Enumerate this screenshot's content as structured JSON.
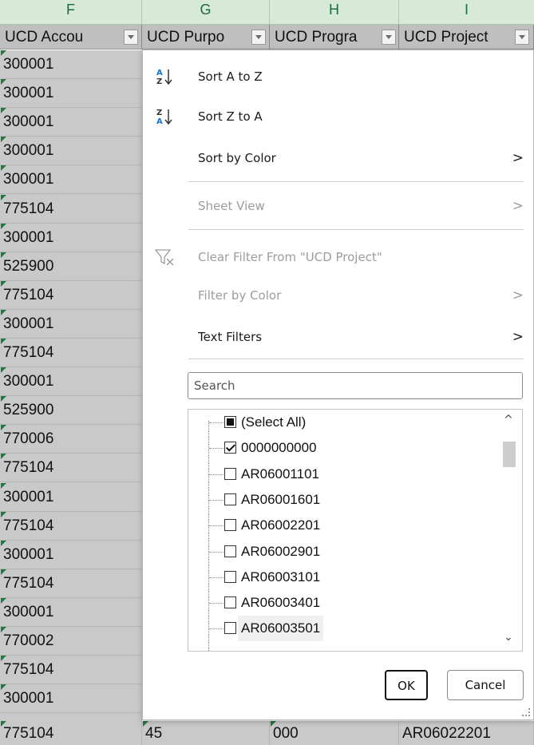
{
  "column_letters": [
    "F",
    "G",
    "H",
    "I"
  ],
  "headers": [
    {
      "label": "UCD Accou",
      "has_dropdown": true
    },
    {
      "label": "UCD Purpo",
      "has_dropdown": true
    },
    {
      "label": "UCD Progra",
      "has_dropdown": true
    },
    {
      "label": "UCD Project",
      "has_dropdown": true
    }
  ],
  "col_f_values": [
    "300001",
    "300001",
    "300001",
    "300001",
    "300001",
    "775104",
    "300001",
    "525900",
    "775104",
    "300001",
    "775104",
    "300001",
    "525900",
    "770006",
    "775104",
    "300001",
    "775104",
    "300001",
    "775104",
    "300001",
    "770002",
    "775104",
    "300001"
  ],
  "bottom_row": {
    "f": "775104",
    "g": "45",
    "h": "000",
    "i": "AR06022201"
  },
  "menu": {
    "sort_az": "Sort A to Z",
    "sort_za": "Sort Z to A",
    "sort_by_color": "Sort by Color",
    "sheet_view": "Sheet View",
    "clear_filter": "Clear Filter From \"UCD Project\"",
    "filter_by_color": "Filter by Color",
    "text_filters": "Text Filters",
    "chevron": ">"
  },
  "search": {
    "placeholder": "Search"
  },
  "filter_list": [
    {
      "label": "(Select All)",
      "state": "partial"
    },
    {
      "label": "0000000000",
      "state": "checked"
    },
    {
      "label": "AR06001101",
      "state": "unchecked"
    },
    {
      "label": "AR06001601",
      "state": "unchecked"
    },
    {
      "label": "AR06002201",
      "state": "unchecked"
    },
    {
      "label": "AR06002901",
      "state": "unchecked"
    },
    {
      "label": "AR06003101",
      "state": "unchecked"
    },
    {
      "label": "AR06003401",
      "state": "unchecked"
    },
    {
      "label": "AR06003501",
      "state": "unchecked"
    }
  ],
  "buttons": {
    "ok": "OK",
    "cancel": "Cancel"
  },
  "colors": {
    "header_green": "#d7ead9",
    "cell_gray": "#c9c9c9",
    "triangle_green": "#1f7a3c",
    "disabled_text": "#9c9c9c"
  }
}
